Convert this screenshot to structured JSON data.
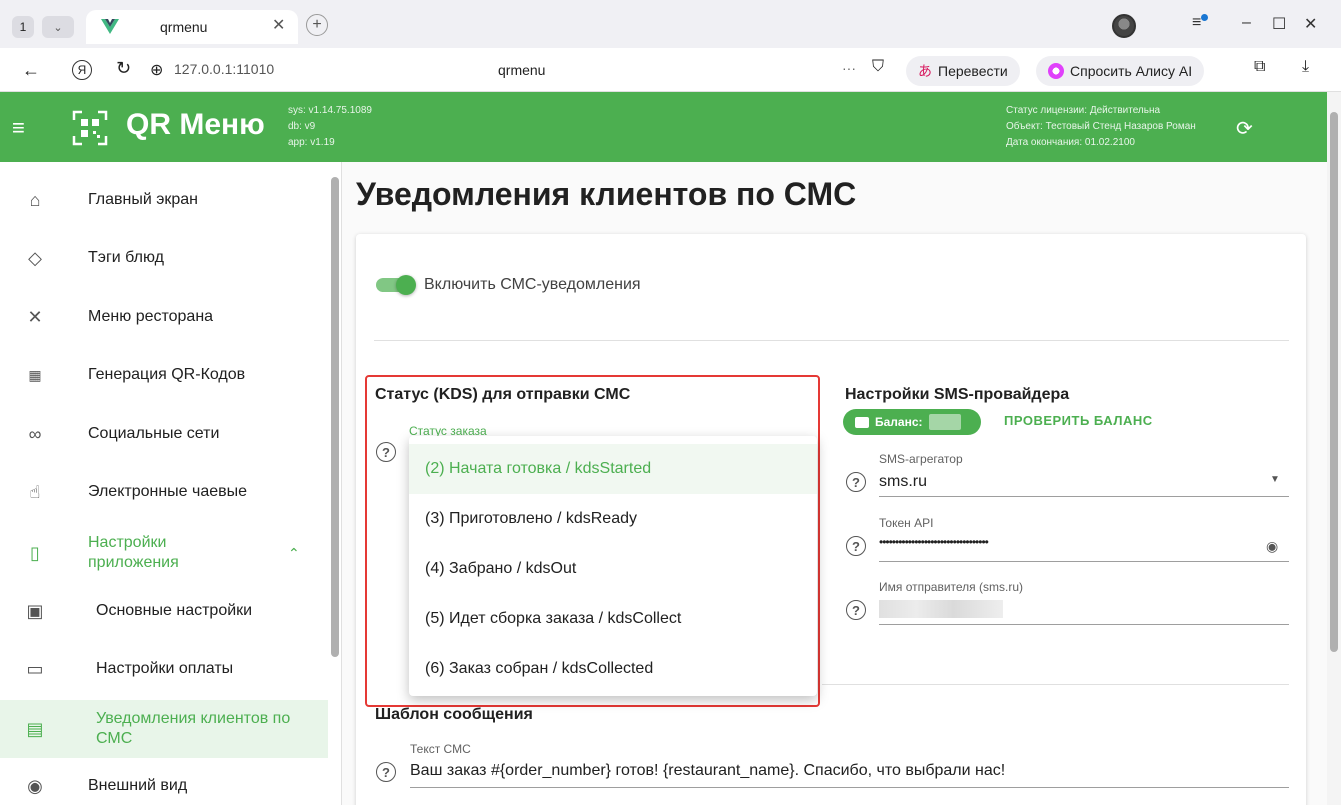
{
  "browser": {
    "tab_count": "1",
    "tab_title": "qrmenu",
    "address": "127.0.0.1:11010",
    "page_title": "qrmenu",
    "translate_label": "Перевести",
    "alice_label": "Спросить Алису AI"
  },
  "header": {
    "brand": "QR Меню",
    "sys_version": "sys: v1.14.75.1089",
    "db_version": "db: v9",
    "app_version": "app: v1.19",
    "license_status": "Статус лицензии: Действительна",
    "license_object": "Объект: Тестовый Стенд Назаров Роман",
    "license_end": "Дата окончания: 01.02.2100"
  },
  "sidebar": {
    "items": [
      {
        "label": "Главный экран"
      },
      {
        "label": "Тэги блюд"
      },
      {
        "label": "Меню ресторана"
      },
      {
        "label": "Генерация QR-Кодов"
      },
      {
        "label": "Социальные сети"
      },
      {
        "label": "Электронные чаевые"
      },
      {
        "label": "Настройки приложения"
      },
      {
        "label": "Основные настройки"
      },
      {
        "label": "Настройки оплаты"
      },
      {
        "label": "Уведомления клиентов по СМС"
      },
      {
        "label": "Внешний вид"
      }
    ]
  },
  "main": {
    "title": "Уведомления клиентов по СМС",
    "enable_sms_label": "Включить СМС-уведомления",
    "kds_section_title": "Статус (KDS) для отправки СМС",
    "order_status_label": "Статус заказа",
    "order_status_options": [
      "(2) Начата готовка / kdsStarted",
      "(3) Приготовлено / kdsReady",
      "(4) Забрано / kdsOut",
      "(5) Идет сборка заказа / kdsCollect",
      "(6) Заказ собран / kdsCollected"
    ],
    "provider_section_title": "Настройки SMS-провайдера",
    "balance_label": "Баланс:",
    "check_balance_button": "ПРОВЕРИТЬ БАЛАНС",
    "aggregator_label": "SMS-агрегатор",
    "aggregator_value": "sms.ru",
    "token_label": "Токен API",
    "token_value": "••••••••••••••••••••••••••••••••••",
    "sender_label": "Имя отправителя (sms.ru)",
    "template_section_title": "Шаблон сообщения",
    "sms_text_label": "Текст СМС",
    "sms_text_value": "Ваш заказ #{order_number} готов! {restaurant_name}. Спасибо, что выбрали нас!",
    "help_glyph": "?"
  },
  "colors": {
    "primary": "#4caf50",
    "highlight_border": "#e53935"
  }
}
